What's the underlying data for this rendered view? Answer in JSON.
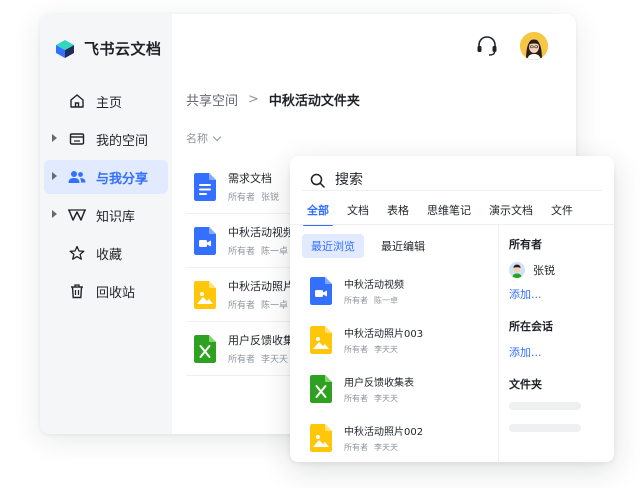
{
  "app": {
    "title": "飞书云文档"
  },
  "sidebar": {
    "items": [
      {
        "label": "主页",
        "icon": "home-icon",
        "expandable": false,
        "active": false
      },
      {
        "label": "我的空间",
        "icon": "folder-icon",
        "expandable": true,
        "active": false
      },
      {
        "label": "与我分享",
        "icon": "users-icon",
        "expandable": true,
        "active": true
      },
      {
        "label": "知识库",
        "icon": "wiki-icon",
        "expandable": true,
        "active": false
      },
      {
        "label": "收藏",
        "icon": "star-icon",
        "expandable": false,
        "active": false
      },
      {
        "label": "回收站",
        "icon": "trash-icon",
        "expandable": false,
        "active": false
      }
    ]
  },
  "breadcrumb": {
    "parent": "共享空间",
    "separator": ">",
    "current": "中秋活动文件夹"
  },
  "sort": {
    "label": "名称"
  },
  "files": [
    {
      "name": "需求文档",
      "owner_label": "所有者",
      "owner": "张锐",
      "type": "doc"
    },
    {
      "name": "中秋活动视频",
      "owner_label": "所有者",
      "owner": "陈一卓",
      "type": "video"
    },
    {
      "name": "中秋活动照片",
      "owner_label": "所有者",
      "owner": "陈一卓",
      "type": "image"
    },
    {
      "name": "用户反馈收集",
      "owner_label": "所有者",
      "owner": "李天天",
      "type": "sheet"
    }
  ],
  "search": {
    "placeholder": "搜索",
    "tabs": [
      "全部",
      "文档",
      "表格",
      "思维笔记",
      "演示文档",
      "文件"
    ],
    "active_tab": 0,
    "subtabs": [
      "最近浏览",
      "最近编辑"
    ],
    "active_subtab": 0,
    "results": [
      {
        "name": "中秋活动视频",
        "owner_label": "所有者",
        "owner": "陈一卓",
        "type": "video"
      },
      {
        "name": "中秋活动照片003",
        "owner_label": "所有者",
        "owner": "李天天",
        "type": "image"
      },
      {
        "name": "用户反馈收集表",
        "owner_label": "所有者",
        "owner": "李天天",
        "type": "sheet"
      },
      {
        "name": "中秋活动照片002",
        "owner_label": "所有者",
        "owner": "李天天",
        "type": "image"
      }
    ],
    "filters": {
      "owner_title": "所有者",
      "owner_name": "张锐",
      "owner_add": "添加...",
      "chat_title": "所在会话",
      "chat_add": "添加...",
      "folder_title": "文件夹"
    }
  },
  "colors": {
    "accent": "#3370ff",
    "active_bg": "#e1eaff",
    "doc": "#3370ff",
    "video": "#3370ff",
    "image": "#ffc60a",
    "sheet": "#2ea121"
  }
}
